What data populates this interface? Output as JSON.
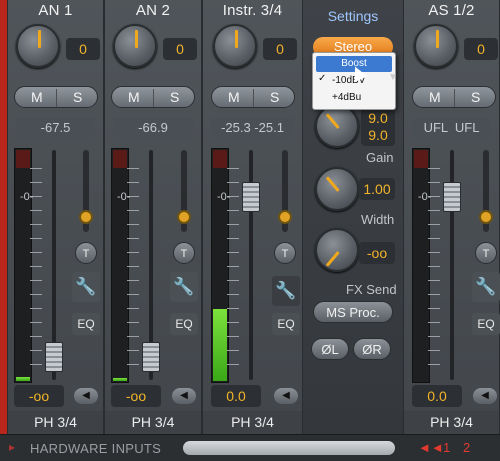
{
  "channels": [
    {
      "title": "AN 1",
      "gain": "0",
      "mute": "M",
      "solo": "S",
      "peak": "-67.5",
      "level": "-oo",
      "label": "PH 3/4"
    },
    {
      "title": "AN 2",
      "gain": "0",
      "mute": "M",
      "solo": "S",
      "peak": "-66.9",
      "level": "-oo",
      "label": "PH 3/4"
    },
    {
      "title": "Instr. 3/4",
      "gain": "0",
      "mute": "M",
      "solo": "S",
      "peak": "-25.3 -25.1",
      "level": "0.0",
      "label": "PH 3/4"
    },
    {
      "title": "AS 1/2",
      "gain": "0",
      "mute": "M",
      "solo": "S",
      "peak": "UFL  UFL",
      "level": "0.0",
      "label": "PH 3/4"
    }
  ],
  "strip_controls": {
    "t_label": "T",
    "eq_label": "EQ",
    "zero_mark": "-0-"
  },
  "settings": {
    "title": "Settings",
    "stereo": "Stereo",
    "gain_label": "Gain",
    "gain_values": [
      "9.0",
      "9.0"
    ],
    "gain_knob_value": "1.00",
    "width_label": "Width",
    "width_value": "-oo",
    "fx_send_label": "FX Send",
    "ms_proc": "MS Proc.",
    "phase_l": "ØL",
    "phase_r": "ØR"
  },
  "popup_menu": {
    "items": [
      "Boost",
      "-10dBV",
      "+4dBu"
    ],
    "selected": "Boost",
    "checked": "-10dBV"
  },
  "footer": {
    "section_label": "HARDWARE INPUTS",
    "pages": [
      "1",
      "2"
    ],
    "arrow": "◄◄"
  },
  "colors": {
    "accent": "#f2b42a",
    "stereo_button": "#e07716",
    "selection": "#3b7ad0",
    "meter_green": "#7ce23c",
    "red_bar": "#b8261c"
  }
}
